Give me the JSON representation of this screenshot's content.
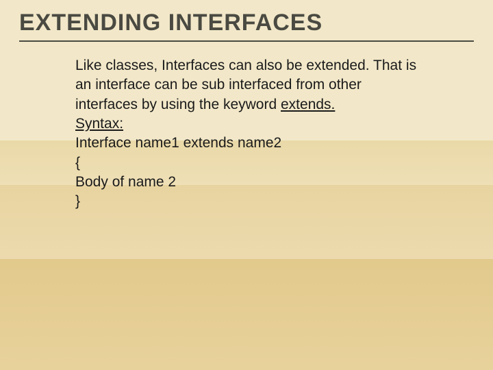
{
  "title": "EXTENDING INTERFACES",
  "body": {
    "p1a": "Like classes, Interfaces can also be extended. That is  an interface can be sub interfaced from other interfaces by using the keyword ",
    "p1_underlined": "extends.",
    "p2_underlined": "Syntax:",
    "p3": "Interface name1 extends name2",
    "p4": "{",
    "p5": "Body of name 2",
    "p6": "}"
  }
}
